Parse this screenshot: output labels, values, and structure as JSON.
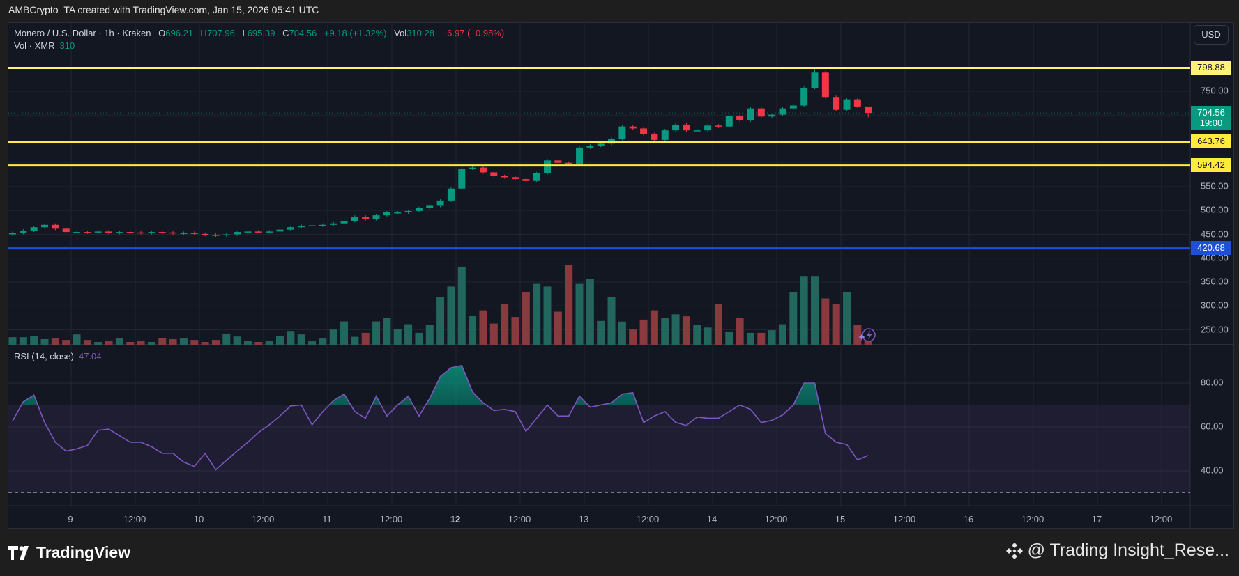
{
  "credit": "AMBCrypto_TA created with TradingView.com, Jan 15, 2026 05:41 UTC",
  "legend": {
    "symbol": "Monero / U.S. Dollar · 1h · Kraken",
    "o_label": "O",
    "o": "696.21",
    "h_label": "H",
    "h": "707.96",
    "l_label": "L",
    "l": "695.39",
    "c_label": "C",
    "c": "704.56",
    "change": "+9.18 (+1.32%)",
    "vol_label": "Vol",
    "vol": "310.28",
    "vol_change": "−6.97 (−0.98%)",
    "vol_line_label": "Vol · XMR",
    "vol_line_value": "310"
  },
  "rsi_legend": {
    "label": "RSI (14, close)",
    "value": "47.04"
  },
  "currency_button": "USD",
  "current_price": {
    "price": "704.56",
    "countdown": "19:00"
  },
  "levels": [
    {
      "value": 798.88,
      "label": "798.88",
      "color": "#fff176"
    },
    {
      "value": 643.76,
      "label": "643.76",
      "color": "#ffeb3b"
    },
    {
      "value": 594.42,
      "label": "594.42",
      "color": "#ffeb3b"
    },
    {
      "value": 420.68,
      "label": "420.68",
      "color": "#1e4fd8"
    }
  ],
  "colors": {
    "up": "#089981",
    "down": "#f23645",
    "vol_up": "#22675e",
    "vol_down": "#8a3a3f",
    "rsi": "#7e57c2",
    "background": "#131722"
  },
  "footer": {
    "logo": "TradingView",
    "watermark": "@ Trading Insight_Rese..."
  },
  "chart_data": {
    "type": "candlestick",
    "interval": "1h",
    "price_axis_ticks": [
      "750.00",
      "550.00",
      "500.00",
      "450.00",
      "400.00",
      "350.00",
      "300.00",
      "250.00"
    ],
    "rsi_axis_ticks": [
      "80.00",
      "60.00",
      "40.00"
    ],
    "rsi_bands": [
      70,
      50,
      30
    ],
    "time_axis_ticks": [
      "9",
      "12:00",
      "10",
      "12:00",
      "11",
      "12:00",
      "12",
      "12:00",
      "13",
      "12:00",
      "14",
      "12:00",
      "15",
      "12:00",
      "16",
      "12:00",
      "17",
      "12:00"
    ],
    "grid": true,
    "time": [
      "Jan 8 13:00",
      "Jan 8 15:00",
      "Jan 8 17:00",
      "Jan 8 19:00",
      "Jan 8 21:00",
      "Jan 8 23:00",
      "Jan 9 01:00",
      "Jan 9 03:00",
      "Jan 9 05:00",
      "Jan 9 07:00",
      "Jan 9 09:00",
      "Jan 9 11:00",
      "Jan 9 13:00",
      "Jan 9 15:00",
      "Jan 9 17:00",
      "Jan 9 19:00",
      "Jan 9 21:00",
      "Jan 9 23:00",
      "Jan 10 01:00",
      "Jan 10 03:00",
      "Jan 10 05:00",
      "Jan 10 07:00",
      "Jan 10 09:00",
      "Jan 10 11:00",
      "Jan 10 13:00",
      "Jan 10 15:00",
      "Jan 10 17:00",
      "Jan 10 19:00",
      "Jan 10 21:00",
      "Jan 10 23:00",
      "Jan 11 01:00",
      "Jan 11 03:00",
      "Jan 11 05:00",
      "Jan 11 07:00",
      "Jan 11 09:00",
      "Jan 11 11:00",
      "Jan 11 13:00",
      "Jan 11 15:00",
      "Jan 11 17:00",
      "Jan 11 19:00",
      "Jan 11 21:00",
      "Jan 11 23:00",
      "Jan 12 01:00",
      "Jan 12 03:00",
      "Jan 12 05:00",
      "Jan 12 07:00",
      "Jan 12 09:00",
      "Jan 12 11:00",
      "Jan 12 13:00",
      "Jan 12 15:00",
      "Jan 12 17:00",
      "Jan 12 19:00",
      "Jan 12 21:00",
      "Jan 12 23:00",
      "Jan 13 01:00",
      "Jan 13 03:00",
      "Jan 13 05:00",
      "Jan 13 07:00",
      "Jan 13 09:00",
      "Jan 13 11:00",
      "Jan 13 13:00",
      "Jan 13 15:00",
      "Jan 13 17:00",
      "Jan 13 19:00",
      "Jan 13 21:00",
      "Jan 13 23:00",
      "Jan 14 01:00",
      "Jan 14 03:00",
      "Jan 14 05:00",
      "Jan 14 07:00",
      "Jan 14 09:00",
      "Jan 14 11:00",
      "Jan 14 13:00",
      "Jan 14 15:00",
      "Jan 14 17:00",
      "Jan 14 19:00",
      "Jan 14 21:00",
      "Jan 14 23:00",
      "Jan 15 01:00",
      "Jan 15 03:00",
      "Jan 15 05:00"
    ],
    "close": [
      453,
      458,
      465,
      470,
      462,
      455,
      455,
      454,
      456,
      453,
      455,
      454,
      453,
      455,
      454,
      452,
      453,
      451,
      449,
      448,
      450,
      455,
      456,
      455,
      456,
      460,
      465,
      468,
      469,
      470,
      473,
      478,
      487,
      482,
      490,
      496,
      496,
      499,
      505,
      510,
      521,
      546,
      588,
      590,
      580,
      572,
      570,
      566,
      562,
      578,
      605,
      600,
      598,
      632,
      636,
      640,
      650,
      676,
      672,
      660,
      648,
      668,
      680,
      668,
      668,
      678,
      676,
      698,
      689,
      714,
      697,
      701,
      714,
      720,
      757,
      789,
      738,
      711,
      733,
      718,
      704.56
    ],
    "volume": [
      570,
      570,
      670,
      420,
      470,
      360,
      780,
      360,
      210,
      260,
      520,
      210,
      260,
      210,
      520,
      420,
      470,
      360,
      210,
      360,
      830,
      620,
      310,
      210,
      260,
      680,
      1040,
      780,
      260,
      470,
      1150,
      1760,
      600,
      900,
      1760,
      2000,
      1200,
      1550,
      900,
      1500,
      3600,
      4400,
      5900,
      2200,
      2600,
      1600,
      3100,
      2100,
      4000,
      4600,
      4400,
      2500,
      6000,
      4600,
      5000,
      1800,
      3600,
      1750,
      1150,
      1900,
      2600,
      2000,
      2300,
      2150,
      1500,
      1300,
      3100,
      1000,
      2000,
      900,
      900,
      1100,
      1550,
      4000,
      5200,
      5200,
      3500,
      3100,
      4000,
      1500,
      310.28
    ],
    "rsi": [
      62.7,
      71.5,
      74.5,
      62,
      53,
      49,
      50,
      51.6,
      58.5,
      59,
      56,
      53,
      53,
      51,
      48,
      48,
      44,
      42,
      48,
      40.5,
      44.8,
      49,
      53,
      57.5,
      61,
      65,
      69.6,
      70,
      61,
      67,
      72,
      75,
      67,
      64,
      74,
      65,
      70,
      74,
      65,
      73,
      83,
      87,
      88,
      76,
      71,
      67.5,
      68,
      67,
      58,
      64,
      70,
      65,
      65,
      74,
      69,
      70,
      71,
      75,
      75.6,
      62,
      65,
      67,
      62,
      60.7,
      64.5,
      64,
      64,
      67,
      70,
      68,
      62,
      63,
      65.5,
      70,
      80,
      80,
      57,
      53,
      52,
      45,
      47.04
    ],
    "last_candle": {
      "open": 696.21,
      "high": 707.96,
      "low": 695.39,
      "close": 704.56
    },
    "session_high": 798.88
  }
}
